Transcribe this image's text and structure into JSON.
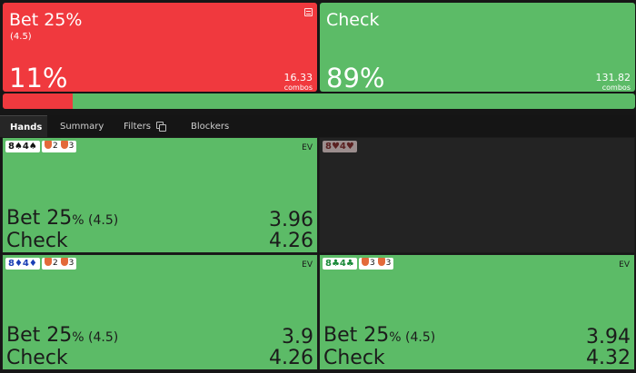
{
  "colors": {
    "bet": "#f0393e",
    "check": "#5cbb67",
    "dark_cell": "#232323"
  },
  "actions": [
    {
      "name": "Bet 25%",
      "size": "(4.5)",
      "percent": "11%",
      "combos": "16.33",
      "combos_label": "combos",
      "frequency": 0.11
    },
    {
      "name": "Check",
      "size": "",
      "percent": "89%",
      "combos": "131.82",
      "combos_label": "combos",
      "frequency": 0.89
    }
  ],
  "tabs": [
    "Hands",
    "Summary",
    "Filters",
    "Blockers"
  ],
  "hands": [
    {
      "hand": "8♠4♠",
      "badges": [
        {
          "count": "2"
        },
        {
          "count": "3"
        }
      ],
      "ev_label": "EV",
      "rows": [
        {
          "label": "Bet 25",
          "suffix": "% (4.5)",
          "value": "3.96"
        },
        {
          "label": "Check",
          "suffix": "",
          "value": "4.26"
        }
      ]
    },
    {
      "hand": "8♥4♥",
      "badges": [],
      "ev_label": "",
      "rows": []
    },
    {
      "hand": "8♦4♦",
      "badges": [
        {
          "count": "2"
        },
        {
          "count": "3"
        }
      ],
      "ev_label": "EV",
      "rows": [
        {
          "label": "Bet 25",
          "suffix": "% (4.5)",
          "value": "3.9"
        },
        {
          "label": "Check",
          "suffix": "",
          "value": "4.26"
        }
      ]
    },
    {
      "hand": "8♣4♣",
      "badges": [
        {
          "count": "3"
        },
        {
          "count": "3"
        }
      ],
      "ev_label": "EV",
      "rows": [
        {
          "label": "Bet 25",
          "suffix": "% (4.5)",
          "value": "3.94"
        },
        {
          "label": "Check",
          "suffix": "",
          "value": "4.32"
        }
      ]
    }
  ]
}
